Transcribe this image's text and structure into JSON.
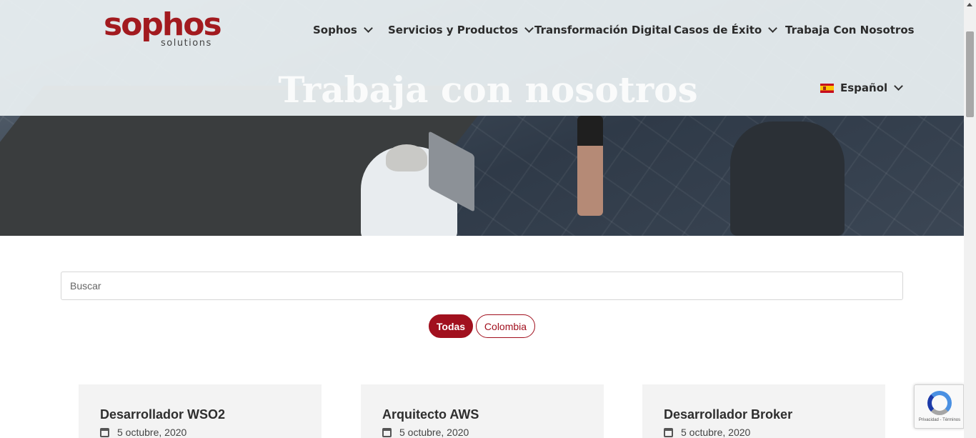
{
  "brand": {
    "name": "sophos",
    "tagline": "solutions",
    "color": "#a21a1f"
  },
  "nav": {
    "items": [
      {
        "label": "Sophos",
        "has_dropdown": true
      },
      {
        "label": "Servicios y Productos",
        "has_dropdown": true
      },
      {
        "label": "Transformación Digital",
        "has_dropdown": false
      },
      {
        "label": "Casos de Éxito",
        "has_dropdown": true
      },
      {
        "label": "Trabaja Con Nosotros",
        "has_dropdown": false
      }
    ],
    "language": {
      "label": "Español",
      "flag": "es-flag-icon"
    }
  },
  "hero": {
    "title": "Trabaja con nosotros"
  },
  "search": {
    "placeholder": "Buscar",
    "value": ""
  },
  "filters": [
    {
      "label": "Todas",
      "active": true
    },
    {
      "label": "Colombia",
      "active": false
    }
  ],
  "jobs": [
    {
      "title": "Desarrollador WSO2",
      "date": "5 octubre, 2020"
    },
    {
      "title": "Arquitecto AWS",
      "date": "5 octubre, 2020"
    },
    {
      "title": "Desarrollador Broker",
      "date": "5 octubre, 2020"
    }
  ],
  "recaptcha": {
    "text": "Privacidad - Términos"
  },
  "colors": {
    "accent": "#a1101e",
    "card_bg": "#f3f3f3",
    "header_overlay": "#ecf2f4"
  }
}
